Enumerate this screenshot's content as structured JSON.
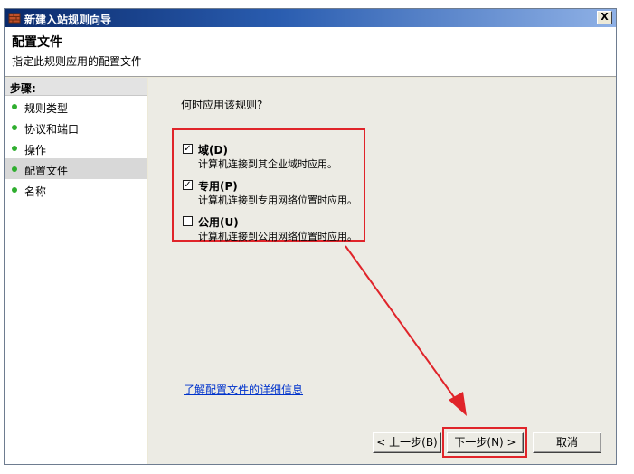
{
  "window": {
    "title": "新建入站规则向导",
    "close_glyph": "X"
  },
  "header": {
    "title": "配置文件",
    "subtitle": "指定此规则应用的配置文件"
  },
  "steps": {
    "heading": "步骤:",
    "items": [
      {
        "label": "规则类型"
      },
      {
        "label": "协议和端口"
      },
      {
        "label": "操作"
      },
      {
        "label": "配置文件"
      },
      {
        "label": "名称"
      }
    ],
    "selected_index": 3
  },
  "main": {
    "question": "何时应用该规则?",
    "options": [
      {
        "label": "域(D)",
        "description": "计算机连接到其企业域时应用。",
        "checked": true
      },
      {
        "label": "专用(P)",
        "description": "计算机连接到专用网络位置时应用。",
        "checked": true
      },
      {
        "label": "公用(U)",
        "description": "计算机连接到公用网络位置时应用。",
        "checked": false
      }
    ],
    "info_link": "了解配置文件的详细信息"
  },
  "buttons": {
    "back": "< 上一步(B)",
    "next": "下一步(N) >",
    "cancel": "取消"
  },
  "colors": {
    "highlight": "#e0242a",
    "step_dot": "#2fae2f",
    "link": "#0033cc"
  }
}
